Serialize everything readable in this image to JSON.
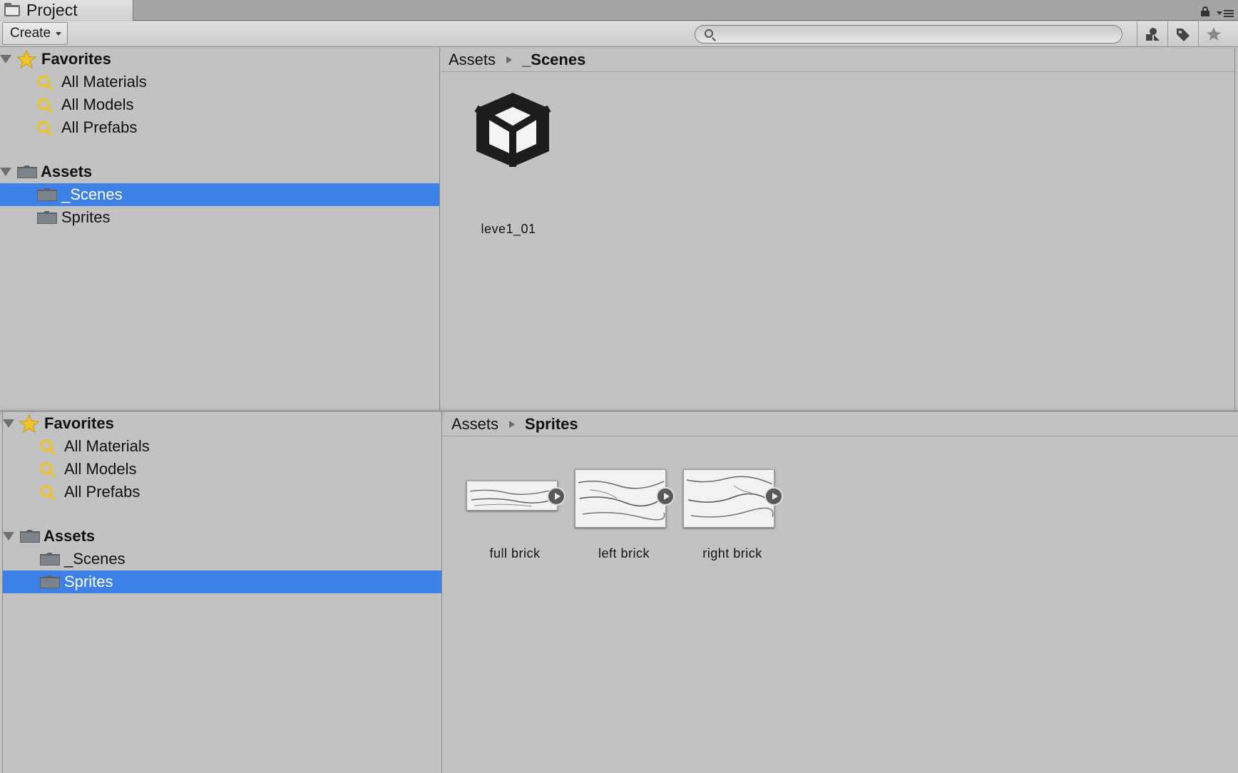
{
  "window": {
    "tab_title": "Project",
    "icons": [
      "folder-icon",
      "lock-icon",
      "menu-icon"
    ]
  },
  "toolbar": {
    "create_label": "Create",
    "search": {
      "value": "",
      "placeholder": ""
    },
    "buttons": [
      "filter-by-type-icon",
      "filter-by-label-icon",
      "favorites-star-icon"
    ]
  },
  "top_view": {
    "tree": {
      "favorites": {
        "label": "Favorites",
        "items": [
          "All Materials",
          "All Models",
          "All Prefabs"
        ]
      },
      "assets": {
        "label": "Assets",
        "items": [
          "_Scenes",
          "Sprites"
        ],
        "selected": "_Scenes"
      }
    },
    "breadcrumb": {
      "root": "Assets",
      "current": "_Scenes"
    },
    "assets": [
      {
        "name": "leve1_01",
        "icon": "unity-scene-icon"
      }
    ]
  },
  "bottom_view": {
    "tree": {
      "favorites": {
        "label": "Favorites",
        "items": [
          "All Materials",
          "All Models",
          "All Prefabs"
        ]
      },
      "assets": {
        "label": "Assets",
        "items": [
          "_Scenes",
          "Sprites"
        ],
        "selected": "Sprites"
      }
    },
    "breadcrumb": {
      "root": "Assets",
      "current": "Sprites"
    },
    "assets": [
      {
        "name": "full brick",
        "icon": "sprite-thumbnail"
      },
      {
        "name": "left brick",
        "icon": "sprite-thumbnail"
      },
      {
        "name": "right brick",
        "icon": "sprite-thumbnail"
      }
    ]
  },
  "colors": {
    "selection": "#3d80e6",
    "panel_bg": "#c2c2c2",
    "star": "#f2c22a",
    "search_icon": "#f0c419"
  }
}
